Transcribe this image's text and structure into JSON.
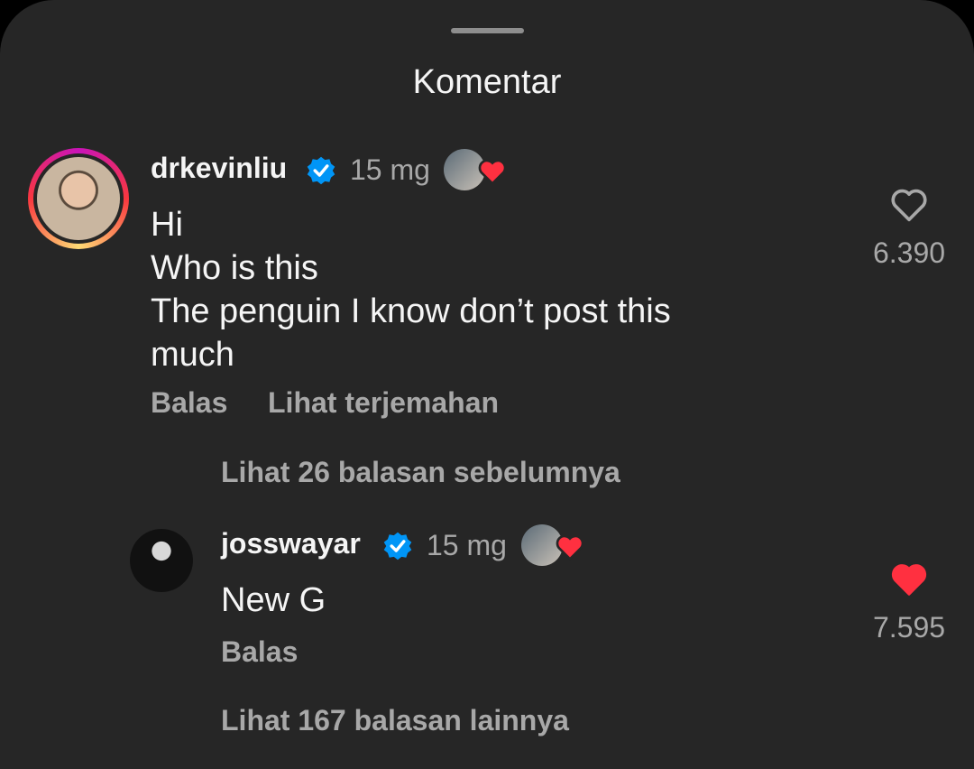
{
  "header": {
    "title": "Komentar"
  },
  "comment": {
    "username": "drkevinliu",
    "time": "15 mg",
    "lines": [
      "Hi",
      "Who is this",
      "The penguin I know don’t post this",
      "much"
    ],
    "reply_label": "Balas",
    "translate_label": "Lihat terjemahan",
    "like_count": "6.390",
    "liked": false
  },
  "view_previous": "Lihat 26 balasan sebelumnya",
  "reply": {
    "username": "josswayar",
    "time": "15 mg",
    "text": "New G",
    "reply_label": "Balas",
    "like_count": "7.595",
    "liked": true
  },
  "view_more": "Lihat 167 balasan lainnya",
  "colors": {
    "background": "#262626",
    "verified": "#0095f6",
    "liked_heart": "#ff3040"
  },
  "icons": [
    "verified-badge-icon",
    "heart-outline-icon",
    "heart-filled-icon",
    "creator-liked-icon"
  ]
}
